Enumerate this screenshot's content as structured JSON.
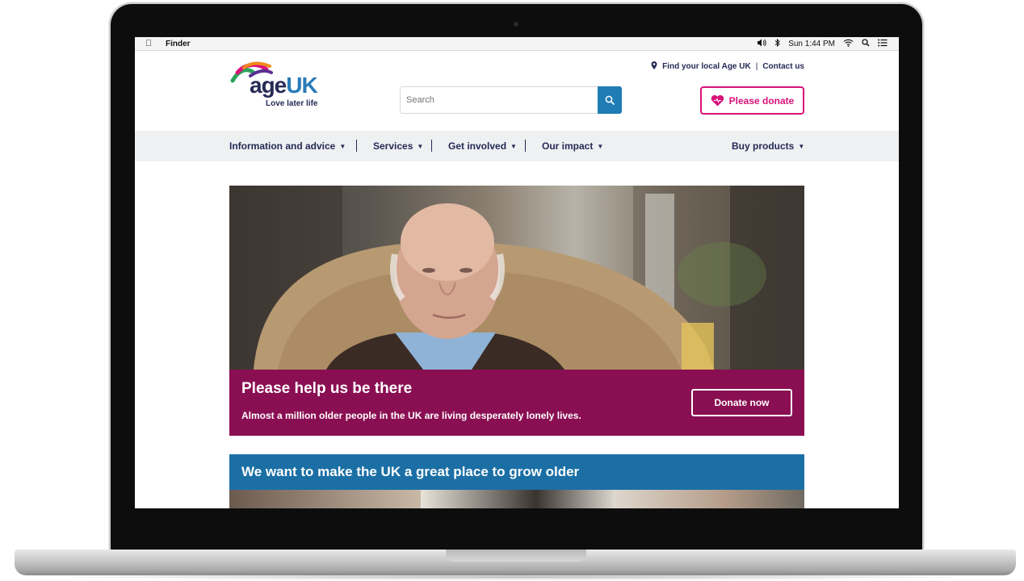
{
  "menubar": {
    "app_name": "Finder",
    "clock": "Sun 1:44 PM"
  },
  "header": {
    "logo_word": "age",
    "logo_uk": "UK",
    "logo_tagline": "Love later life",
    "find_local": "Find your local Age UK",
    "link_separator": "|",
    "contact": "Contact us"
  },
  "search": {
    "placeholder": "Search"
  },
  "donate": {
    "label": "Please donate"
  },
  "nav": {
    "items": [
      {
        "label": "Information and advice"
      },
      {
        "label": "Services"
      },
      {
        "label": "Get involved"
      },
      {
        "label": "Our impact"
      },
      {
        "label": "Buy products"
      }
    ]
  },
  "hero": {
    "title": "Please help us be there",
    "subtitle": "Almost a million older people in the UK are living desperately lonely lives.",
    "button": "Donate now"
  },
  "band": {
    "title": "We want to make the UK a great place to grow older"
  },
  "colors": {
    "brand_navy": "#262a55",
    "brand_pink": "#d9127a",
    "promo_purple": "#8a0f52",
    "band_blue": "#1b6fa5",
    "search_blue": "#1f7cb4"
  }
}
